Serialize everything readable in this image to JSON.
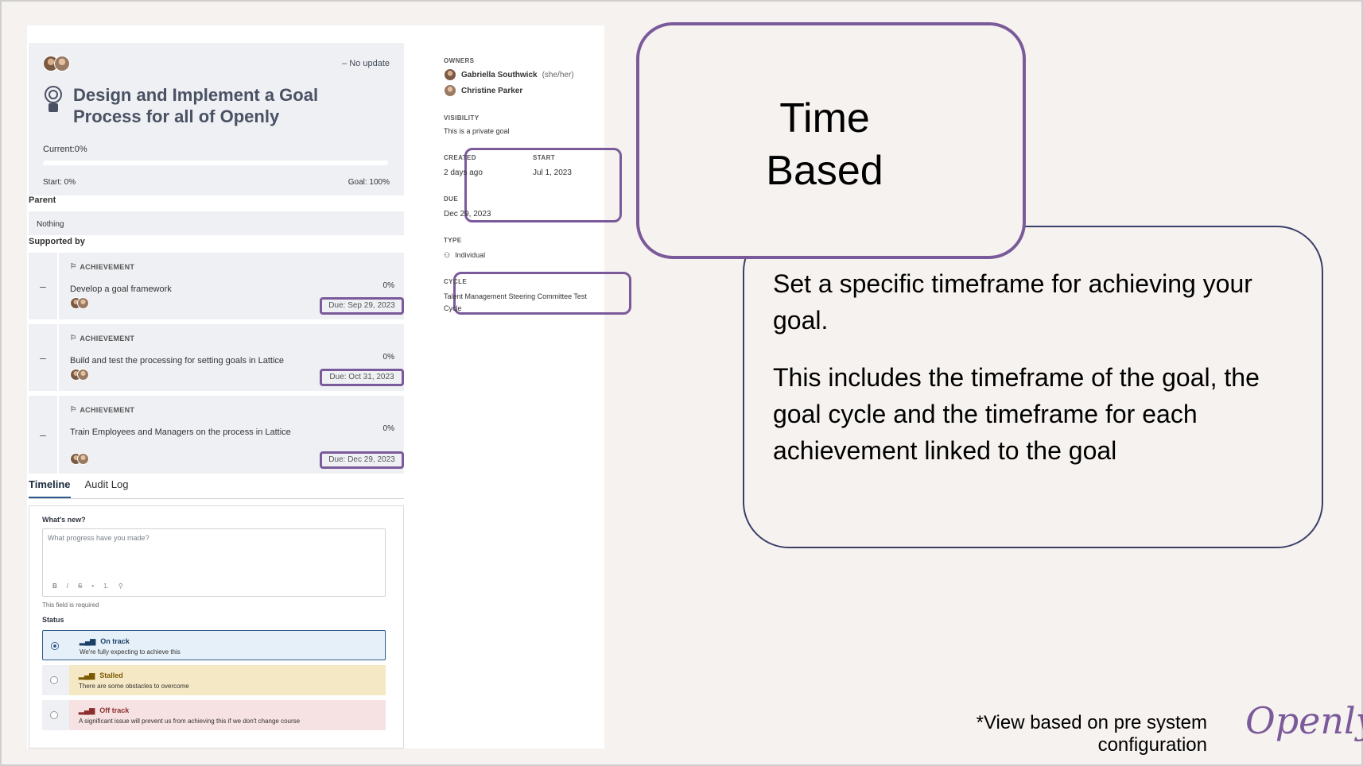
{
  "goal": {
    "update_status": "No update",
    "title": "Design and Implement a Goal Process for all of Openly",
    "current": "Current:0%",
    "current_progress": 0,
    "start": "Start: 0%",
    "goal": "Goal: 100%"
  },
  "parent": {
    "label": "Parent",
    "value": "Nothing"
  },
  "supported": {
    "label": "Supported by",
    "items": [
      {
        "kind": "ACHIEVEMENT",
        "name": "Develop a goal framework",
        "pct": "0%",
        "due": "Due: Sep 29, 2023"
      },
      {
        "kind": "ACHIEVEMENT",
        "name": "Build and test the processing for setting goals in Lattice",
        "pct": "0%",
        "due": "Due: Oct 31, 2023"
      },
      {
        "kind": "ACHIEVEMENT",
        "name": "Train Employees and Managers on the process in Lattice",
        "pct": "0%",
        "due": "Due: Dec 29, 2023"
      }
    ]
  },
  "tabs": [
    "Timeline",
    "Audit Log"
  ],
  "update": {
    "label": "What's new?",
    "placeholder": "What progress have you made?",
    "toolbar": [
      "B",
      "I",
      "S",
      "•",
      "1.",
      "⚲"
    ],
    "required": "This field is required",
    "status_label": "Status",
    "statuses": [
      {
        "title": "On track",
        "desc": "We're fully expecting to achieve this",
        "selected": true,
        "color": "#2e5b8c"
      },
      {
        "title": "Stalled",
        "desc": "There are some obstacles to overcome",
        "selected": false,
        "color": "#b8860b"
      },
      {
        "title": "Off track",
        "desc": "A significant issue will prevent us from achieving this if we don't change course",
        "selected": false,
        "color": "#b04a4a"
      }
    ]
  },
  "details": {
    "owners_label": "OWNERS",
    "owners": [
      {
        "name": "Gabriella Southwick",
        "pronouns": "(she/her)"
      },
      {
        "name": "Christine Parker",
        "pronouns": ""
      }
    ],
    "visibility_label": "VISIBILITY",
    "visibility": "This is a private goal",
    "created_label": "CREATED",
    "created": "2 days ago",
    "start_label": "START",
    "start": "Jul 1, 2023",
    "due_label": "DUE",
    "due": "Dec 29, 2023",
    "type_label": "TYPE",
    "type": "Individual",
    "cycle_label": "CYCLE",
    "cycle": "Talent Management Steering Committee Test Cycle"
  },
  "callout": {
    "title_line1": "Time",
    "title_line2": "Based",
    "para1": "Set a specific timeframe for achieving your goal.",
    "para2": "This includes the timeframe of the goal, the goal cycle and the timeframe for each achievement linked to the goal"
  },
  "footnote": {
    "line1": "*View based on pre system",
    "line2": "configuration"
  },
  "logo": "Openly",
  "colors": {
    "highlight": "#7a5a9a",
    "callout_border": "#3a3f6a",
    "background": "#f6f2ef"
  }
}
